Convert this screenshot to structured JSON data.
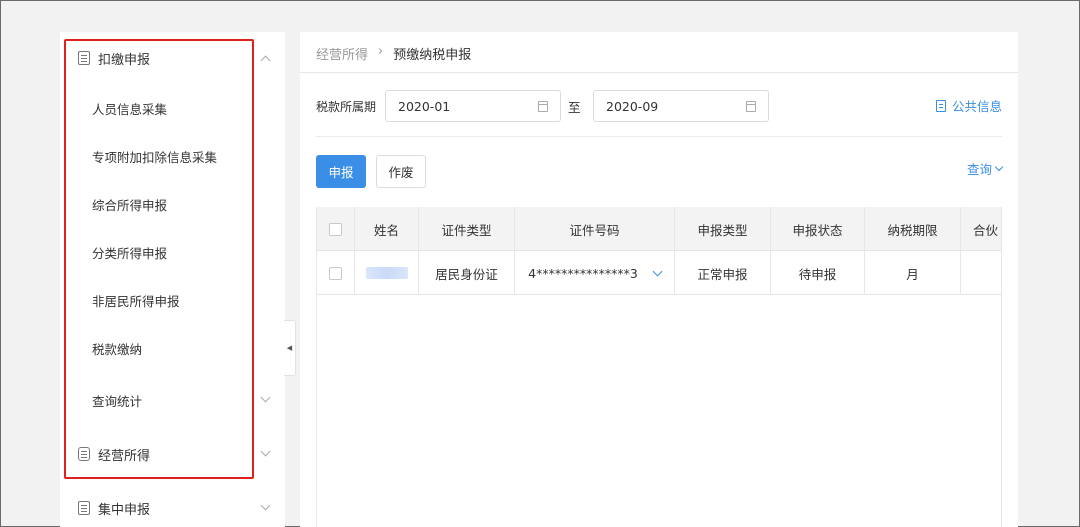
{
  "sidebar": {
    "group_deduct": {
      "label": "扣缴申报",
      "icon": "form-icon",
      "expanded": true
    },
    "items": [
      {
        "label": "人员信息采集"
      },
      {
        "label": "专项附加扣除信息采集"
      },
      {
        "label": "综合所得申报"
      },
      {
        "label": "分类所得申报"
      },
      {
        "label": "非居民所得申报"
      },
      {
        "label": "税款缴纳"
      },
      {
        "label": "查询统计"
      }
    ],
    "group_business": {
      "label": "经营所得",
      "icon": "coin-icon",
      "expanded": false
    },
    "group_central": {
      "label": "集中申报",
      "icon": "form-icon",
      "expanded": false
    }
  },
  "breadcrumb": {
    "parent": "经营所得",
    "separator": "›",
    "current": "预缴纳税申报"
  },
  "filter": {
    "period_label": "税款所属期",
    "start_value": "2020-01",
    "to_label": "至",
    "end_value": "2020-09",
    "public_info_label": "公共信息"
  },
  "toolbar": {
    "declare_label": "申报",
    "void_label": "作废",
    "query_label": "查询"
  },
  "table": {
    "columns": [
      "姓名",
      "证件类型",
      "证件号码",
      "申报类型",
      "申报状态",
      "纳税期限",
      "合伙"
    ],
    "rows": [
      {
        "name": "",
        "id_type": "居民身份证",
        "id_number": "4***************3",
        "declare_type": "正常申报",
        "status": "待申报",
        "period": "月",
        "partner": ""
      }
    ]
  },
  "colors": {
    "accent": "#3a8ee6",
    "highlight": "#e0201d",
    "background": "#f2f2f2"
  }
}
